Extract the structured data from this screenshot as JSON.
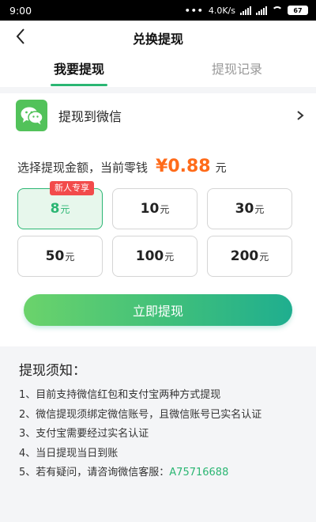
{
  "status_bar": {
    "time": "9:00",
    "dots": "•••",
    "network_speed": "4.0K/s",
    "battery": "67"
  },
  "navbar": {
    "title": "兑换提现"
  },
  "tabs": [
    {
      "label": "我要提现",
      "active": true
    },
    {
      "label": "提现记录",
      "active": false
    }
  ],
  "withdraw_to": {
    "label": "提现到微信",
    "icon": "wechat-icon"
  },
  "amount": {
    "prompt": "选择提现金额，当前零钱",
    "value": "¥0.88",
    "unit": "元"
  },
  "options": [
    {
      "amount": "8",
      "unit": "元",
      "badge": "新人专享",
      "selected": true
    },
    {
      "amount": "10",
      "unit": "元",
      "selected": false
    },
    {
      "amount": "30",
      "unit": "元",
      "selected": false
    },
    {
      "amount": "50",
      "unit": "元",
      "selected": false
    },
    {
      "amount": "100",
      "unit": "元",
      "selected": false
    },
    {
      "amount": "200",
      "unit": "元",
      "selected": false
    }
  ],
  "cta": {
    "label": "立即提现"
  },
  "notice": {
    "title": "提现须知：",
    "items": [
      "1、目前支持微信红包和支付宝两种方式提现",
      "2、微信提现须绑定微信账号，且微信账号已实名认证",
      "3、支付宝需要经过实名认证",
      "4、当日提现当日到账",
      "5、若有疑问，请咨询微信客服："
    ],
    "contact_id": "A75716688"
  },
  "colors": {
    "accent": "#2bb673",
    "price": "#ff6b1a",
    "badge": "#f24b4b",
    "wechat": "#52c25a"
  }
}
